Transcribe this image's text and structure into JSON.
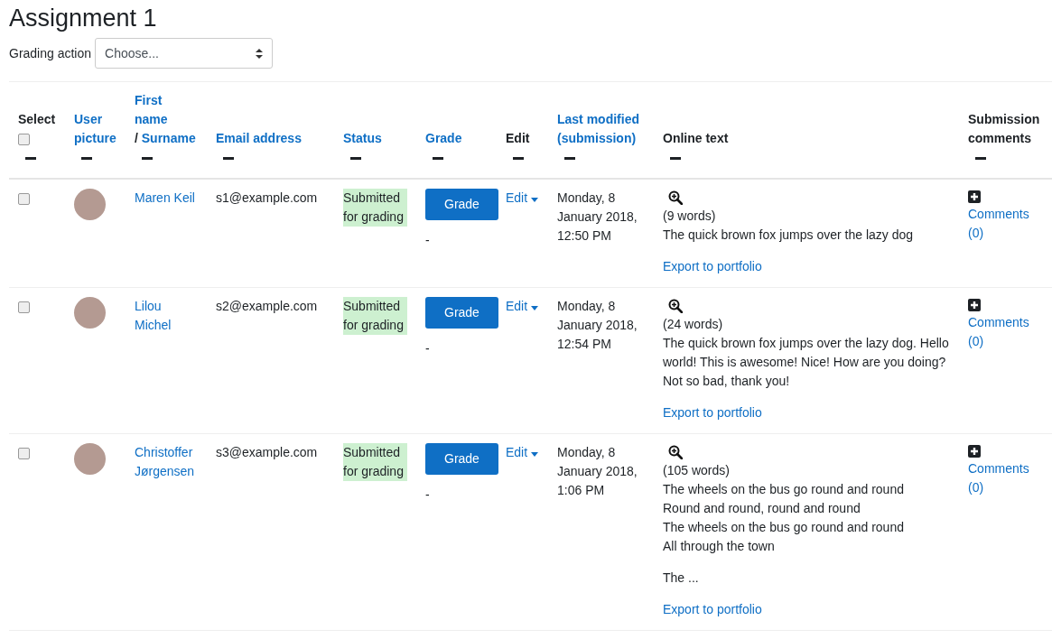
{
  "page_title": "Assignment 1",
  "grading_action": {
    "label": "Grading action",
    "value": "Choose..."
  },
  "table": {
    "columns": [
      {
        "label": "Select",
        "sortable": false,
        "kind": "select",
        "checked": false
      },
      {
        "label": "User picture",
        "sortable": true
      },
      {
        "label": "First name",
        "separator": "/",
        "label_2": "Surname",
        "sortable": true,
        "kind": "name"
      },
      {
        "label": "Email address",
        "sortable": true
      },
      {
        "label": "Status",
        "sortable": true
      },
      {
        "label": "Grade",
        "sortable": true
      },
      {
        "label": "Edit",
        "sortable": false
      },
      {
        "label": "Last modified (submission)",
        "sortable": true
      },
      {
        "label": "Online text",
        "sortable": false
      },
      {
        "label": "Submission comments",
        "sortable": false
      }
    ],
    "rows": [
      {
        "selected": false,
        "name": "Maren Keil",
        "email": "s1@example.com",
        "status": "Submitted for grading",
        "grade_button": "Grade",
        "grade": "-",
        "edit": "Edit",
        "modified": "Monday, 8 January 2018, 12:50 PM",
        "word_count": "(9 words)",
        "paragraphs": [
          "The quick brown fox jumps over the lazy dog"
        ],
        "export": "Export to portfolio",
        "comments": "Comments (0)"
      },
      {
        "selected": false,
        "name": "Lilou Michel",
        "email": "s2@example.com",
        "status": "Submitted for grading",
        "grade_button": "Grade",
        "grade": "-",
        "edit": "Edit",
        "modified": "Monday, 8 January 2018, 12:54 PM",
        "word_count": "(24 words)",
        "paragraphs": [
          "The quick brown fox jumps over the lazy dog. Hello world! This is awesome! Nice! How are you doing? Not so bad, thank you!"
        ],
        "export": "Export to portfolio",
        "comments": "Comments (0)"
      },
      {
        "selected": false,
        "name": "Christoffer Jørgensen",
        "email": "s3@example.com",
        "status": "Submitted for grading",
        "grade_button": "Grade",
        "grade": "-",
        "edit": "Edit",
        "modified": "Monday, 8 January 2018, 1:06 PM",
        "word_count": "(105 words)",
        "paragraphs": [
          "The wheels on the bus go round and round\nRound and round, round and round\nThe wheels on the bus go round and round\nAll through the town",
          "The ..."
        ],
        "export": "Export to portfolio",
        "comments": "Comments (0)"
      }
    ]
  }
}
